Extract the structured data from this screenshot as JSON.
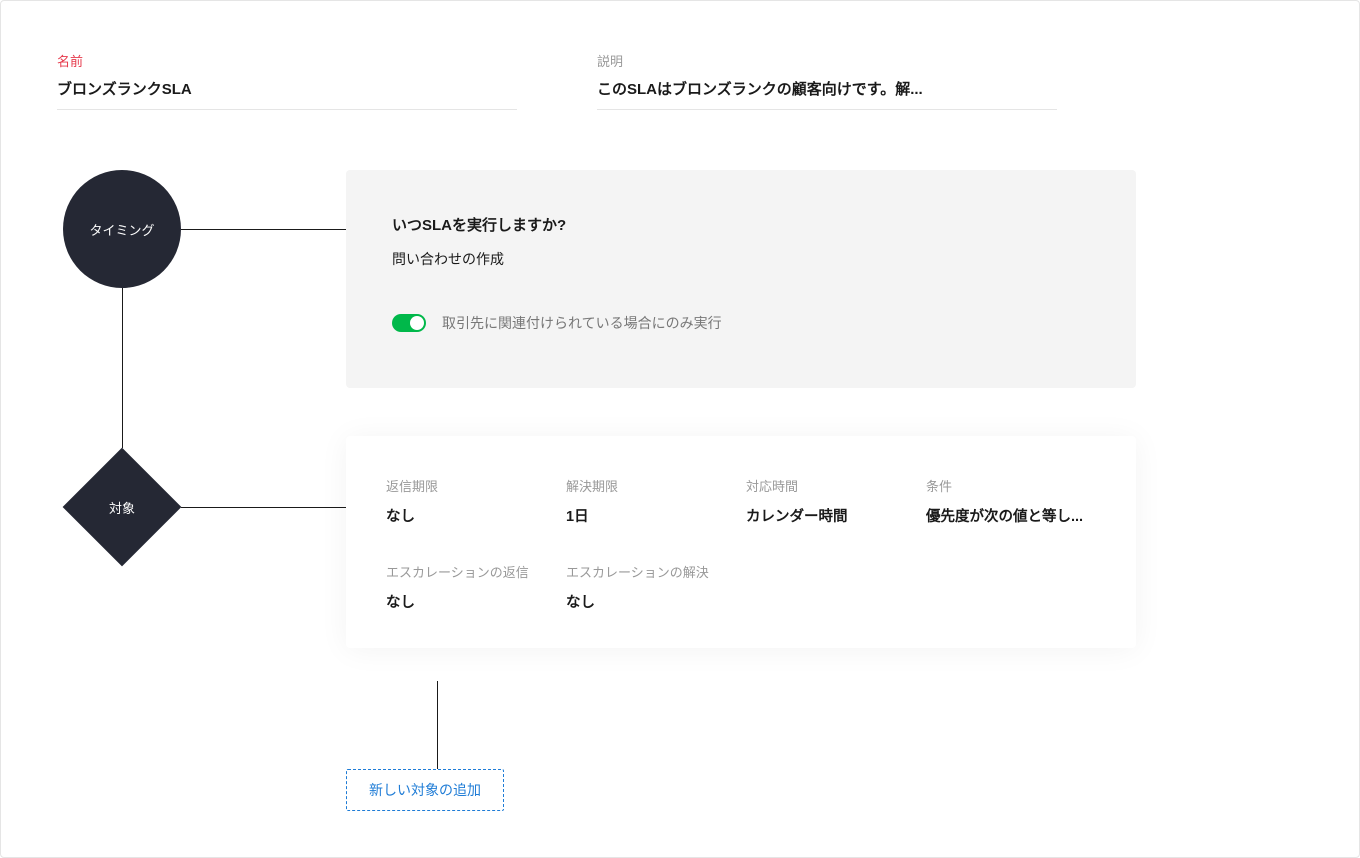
{
  "header": {
    "name_label": "名前",
    "name_value": "ブロンズランクSLA",
    "description_label": "説明",
    "description_value": "このSLAはブロンズランクの顧客向けです。解..."
  },
  "nodes": {
    "timing_label": "タイミング",
    "target_label": "対象"
  },
  "timing_card": {
    "title": "いつSLAを実行しますか?",
    "value": "問い合わせの作成",
    "toggle_label": "取引先に関連付けられている場合にのみ実行"
  },
  "target_card": {
    "fields": [
      {
        "label": "返信期限",
        "value": "なし"
      },
      {
        "label": "解決期限",
        "value": "1日"
      },
      {
        "label": "対応時間",
        "value": "カレンダー時間"
      },
      {
        "label": "条件",
        "value": "優先度が次の値と等し..."
      },
      {
        "label": "エスカレーションの返信",
        "value": "なし"
      },
      {
        "label": "エスカレーションの解決",
        "value": "なし"
      }
    ]
  },
  "add_button": {
    "label": "新しい対象の追加"
  }
}
